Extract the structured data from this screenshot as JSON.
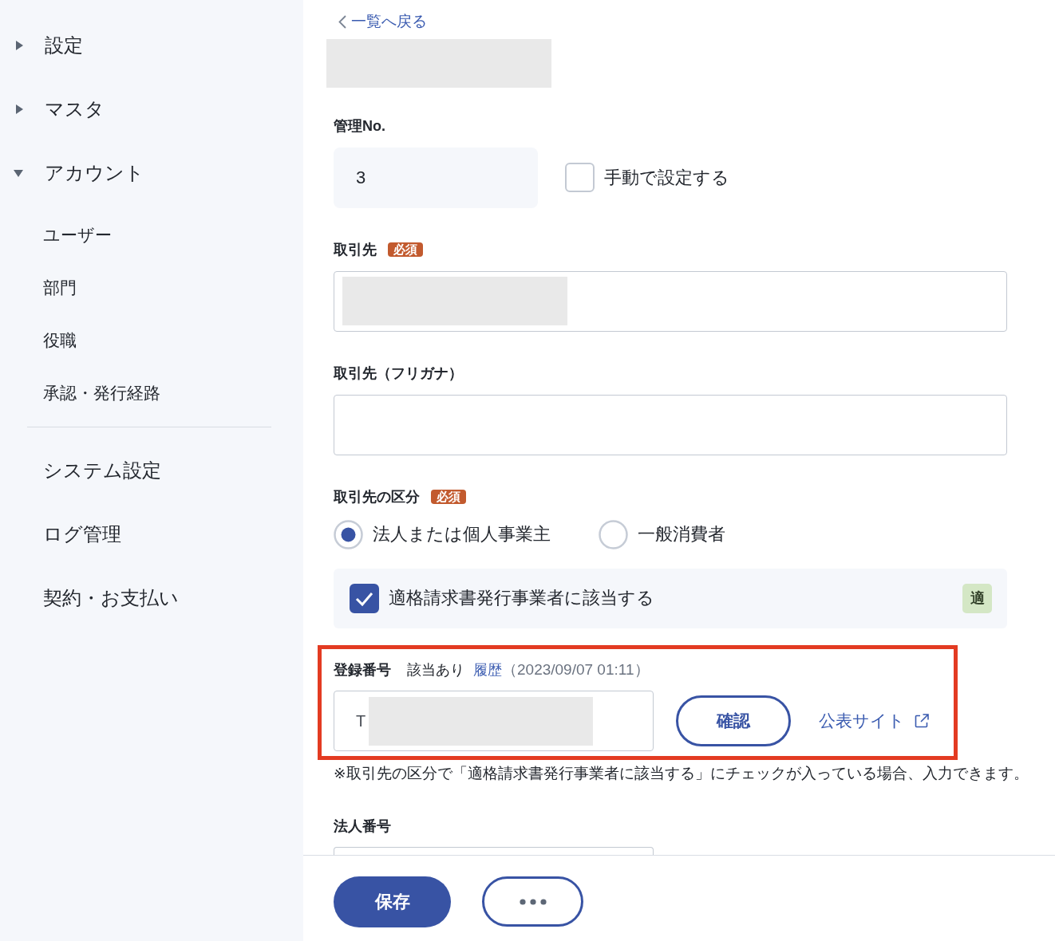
{
  "sidebar": {
    "primary_items": [
      {
        "label": "設定",
        "expanded": false
      },
      {
        "label": "マスタ",
        "expanded": false
      },
      {
        "label": "アカウント",
        "expanded": true,
        "children": [
          {
            "label": "ユーザー"
          },
          {
            "label": "部門"
          },
          {
            "label": "役職"
          },
          {
            "label": "承認・発行経路"
          }
        ]
      }
    ],
    "secondary_items": [
      {
        "label": "システム設定"
      },
      {
        "label": "ログ管理"
      },
      {
        "label": "契約・お支払い"
      }
    ]
  },
  "back_link": {
    "label": "一覧へ戻る"
  },
  "page_title": {
    "redacted": true
  },
  "form": {
    "fields": [
      {
        "kind": "number",
        "label": "管理No.",
        "value": "3",
        "option": {
          "label": "手動で設定する",
          "checked": false
        }
      },
      {
        "kind": "text",
        "label": "取引先",
        "required_badge": "必須",
        "value_redacted": true
      },
      {
        "kind": "text",
        "label": "取引先（フリガナ）"
      },
      {
        "kind": "choice",
        "label": "取引先の区分",
        "required_badge": "必須",
        "options": [
          {
            "label": "法人または個人事業主",
            "selected": true
          },
          {
            "label": "一般消費者",
            "selected": false
          }
        ],
        "qualified": {
          "label": "適格請求書発行事業者に該当する",
          "checked": true,
          "tag": "適"
        }
      },
      {
        "kind": "registration",
        "label": "登録番号",
        "highlighted": true,
        "status": "該当あり",
        "history_link": "履歴",
        "history_date": "（2023/09/07 01:11）",
        "prefix": "T",
        "value_redacted": true,
        "confirm_button": "確認",
        "site_link": "公表サイト",
        "note": "※取引先の区分で「適格請求書発行事業者に該当する」にチェックが入っている場合、入力できます。"
      },
      {
        "kind": "text",
        "label": "法人番号"
      }
    ]
  },
  "footer": {
    "buttons": [
      {
        "kind": "primary",
        "label": "保存"
      },
      {
        "kind": "more"
      }
    ]
  }
}
